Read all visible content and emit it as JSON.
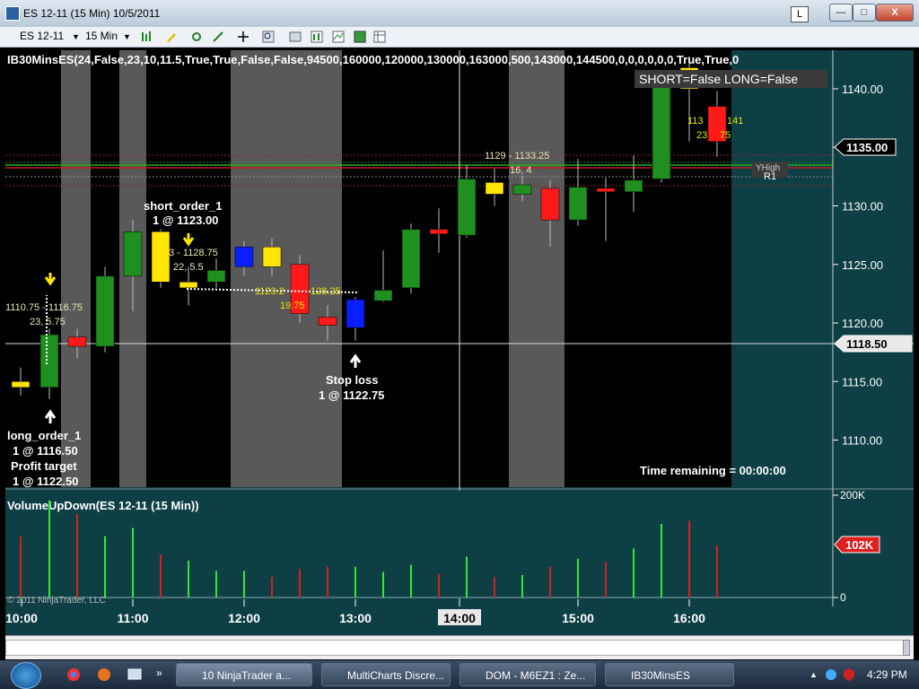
{
  "window": {
    "title": "ES 12-11 (15 Min)  10/5/2011",
    "l_button": "L",
    "minimize": "—",
    "maximize": "□",
    "close": "X"
  },
  "toolbar": {
    "instrument": "ES 12-11",
    "interval": "15 Min"
  },
  "indicator": {
    "label": "IB30MinsES(24,False,23,10,11.5,True,True,False,False,94500,160000,120000,130000,163000,500,143000,144500,0,0,0,0,0,0,True,True,0",
    "status": "SHORT=False LONG=False",
    "time_remaining": "Time remaining = 00:00:00"
  },
  "price_axis": {
    "ticks": [
      "1140.00",
      "1135.00",
      "1130.00",
      "1125.00",
      "1120.00",
      "1115.00",
      "1110.00"
    ],
    "current_badge": "1135.00",
    "crosshair_badge": "1118.50"
  },
  "volume_panel": {
    "label": "VolumeUpDown(ES 12-11 (15 Min))",
    "ticks": [
      "200K",
      "0"
    ],
    "badge": "102K",
    "copyright": "© 2011 NinjaTrader, LLC"
  },
  "time_axis": {
    "ticks": [
      "10:00",
      "11:00",
      "12:00",
      "13:00",
      "14:00",
      "15:00",
      "16:00"
    ],
    "highlight": "14:00"
  },
  "annotations": {
    "long_order": "long_order_1",
    "long_order_fill": "1 @ 1116.50",
    "profit_target": "Profit target",
    "profit_target_fill": "1 @ 1122.50",
    "short_order": "short_order_1",
    "short_order_fill": "1 @ 1123.00",
    "stop_loss": "Stop loss",
    "stop_loss_fill": "1 @ 1122.75",
    "trade1_range": "1110.75 - 1116.75",
    "trade1_size": "23, 5.75",
    "trade2_range": "3 - 1128.75",
    "trade2_size": "22, 5.5",
    "trade3_range": "1123.2",
    "trade3_range_b": "128.25",
    "trade3_size": "19.75",
    "trade4_range": "1129 - 1133.25",
    "trade4_size": "16, 4",
    "trade5_range": "113",
    "trade5_range_b": "141",
    "trade5_size": "23",
    "trade5_size_b": "75",
    "yhigh": "YHigh",
    "r1": "R1"
  },
  "taskbar": {
    "tasks": [
      "10 NinjaTrader a...",
      "MultiCharts Discre...",
      "DOM - M6EZ1 : Ze...",
      "IB30MinsES"
    ],
    "clock": "4:29 PM"
  },
  "colors": {
    "up": "#1f8f1f",
    "down": "#ff1a1a",
    "yellow": "#ffe500",
    "blue": "#0a1fff",
    "panel_bg": "#0d3f45"
  }
}
